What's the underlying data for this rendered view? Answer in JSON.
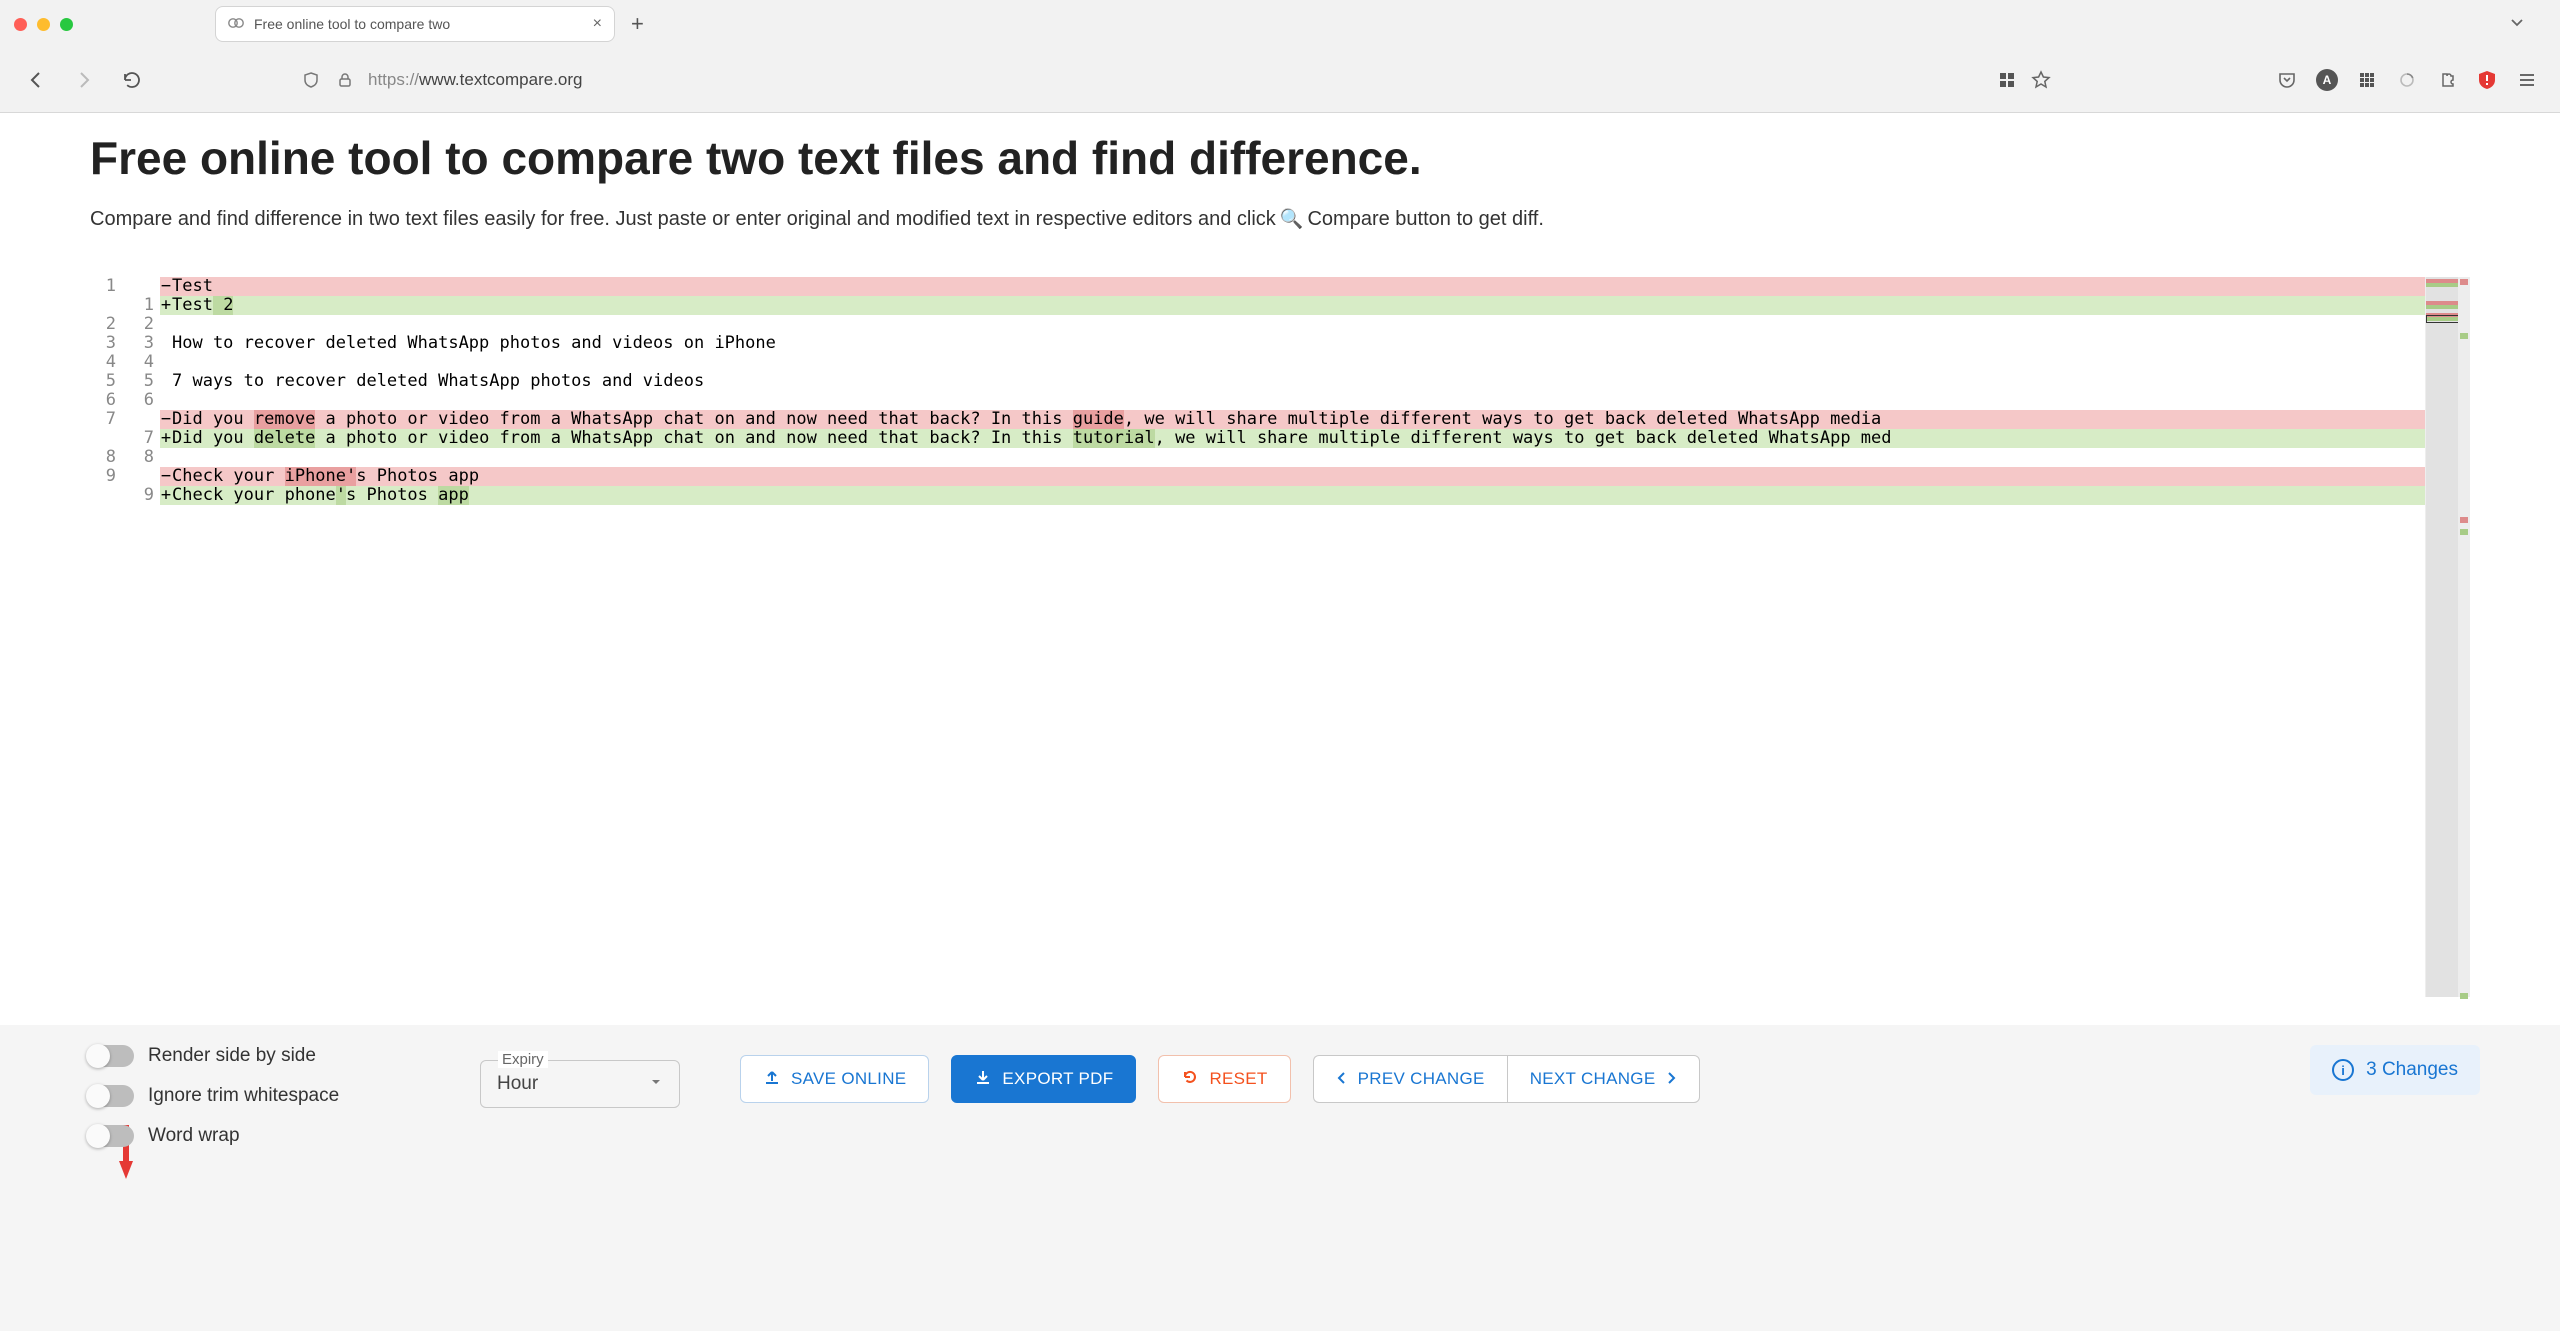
{
  "browser": {
    "tab_title": "Free online tool to compare two",
    "url_scheme": "https://",
    "url_rest": "www.textcompare.org"
  },
  "page": {
    "title": "Free online tool to compare two text files and find difference.",
    "subtitle_before": "Compare and find difference in two text files easily for free. Just paste or enter original and modified text in respective editors and click ",
    "subtitle_after": " Compare button to get diff."
  },
  "diff": {
    "rows": [
      {
        "l": "1",
        "r": "",
        "marker": "−",
        "kind": "del",
        "segs": [
          {
            "t": "Test",
            "hl": false
          }
        ]
      },
      {
        "l": "",
        "r": "1",
        "marker": "+",
        "kind": "add",
        "segs": [
          {
            "t": "Test",
            "hl": false
          },
          {
            "t": " 2",
            "hl": true
          }
        ]
      },
      {
        "l": "2",
        "r": "2",
        "marker": "",
        "kind": "ctx",
        "segs": [
          {
            "t": "",
            "hl": false
          }
        ]
      },
      {
        "l": "3",
        "r": "3",
        "marker": "",
        "kind": "ctx",
        "segs": [
          {
            "t": "How to recover deleted WhatsApp photos and videos on iPhone",
            "hl": false
          }
        ]
      },
      {
        "l": "4",
        "r": "4",
        "marker": "",
        "kind": "ctx",
        "segs": [
          {
            "t": "",
            "hl": false
          }
        ]
      },
      {
        "l": "5",
        "r": "5",
        "marker": "",
        "kind": "ctx",
        "segs": [
          {
            "t": "7 ways to recover deleted WhatsApp photos and videos",
            "hl": false
          }
        ]
      },
      {
        "l": "6",
        "r": "6",
        "marker": "",
        "kind": "ctx",
        "segs": [
          {
            "t": "",
            "hl": false
          }
        ]
      },
      {
        "l": "7",
        "r": "",
        "marker": "−",
        "kind": "del",
        "segs": [
          {
            "t": "Did you ",
            "hl": false
          },
          {
            "t": "remove",
            "hl": true
          },
          {
            "t": " a photo or video from a WhatsApp chat on and now need that back? In this ",
            "hl": false
          },
          {
            "t": "guide",
            "hl": true
          },
          {
            "t": ", we will share multiple different ways to get back deleted WhatsApp media ",
            "hl": false
          }
        ]
      },
      {
        "l": "",
        "r": "7",
        "marker": "+",
        "kind": "add",
        "segs": [
          {
            "t": "Did you ",
            "hl": false
          },
          {
            "t": "delete",
            "hl": true
          },
          {
            "t": " a photo or video from a WhatsApp chat on and now need that back? In this ",
            "hl": false
          },
          {
            "t": "tutorial",
            "hl": true
          },
          {
            "t": ", we will share multiple different ways to get back deleted WhatsApp med",
            "hl": false
          }
        ]
      },
      {
        "l": "8",
        "r": "8",
        "marker": "",
        "kind": "ctx",
        "segs": [
          {
            "t": "",
            "hl": false
          }
        ]
      },
      {
        "l": "9",
        "r": "",
        "marker": "−",
        "kind": "del",
        "segs": [
          {
            "t": "Check your ",
            "hl": false
          },
          {
            "t": "iPhone'",
            "hl": true
          },
          {
            "t": "s Photos app",
            "hl": false
          }
        ]
      },
      {
        "l": "",
        "r": "9",
        "marker": "+",
        "kind": "add",
        "segs": [
          {
            "t": "Check your phone",
            "hl": false
          },
          {
            "t": "'",
            "hl": true
          },
          {
            "t": "s Photos ",
            "hl": false
          },
          {
            "t": "app",
            "hl": true
          }
        ]
      }
    ]
  },
  "controls": {
    "toggles": [
      {
        "label": "Render side by side"
      },
      {
        "label": "Ignore trim whitespace"
      },
      {
        "label": "Word wrap"
      }
    ],
    "expiry_label": "Expiry",
    "expiry_value": "Hour",
    "save_online": "SAVE ONLINE",
    "export_pdf": "EXPORT PDF",
    "reset": "RESET",
    "prev_change": "PREV CHANGE",
    "next_change": "NEXT CHANGE",
    "changes_text": "3 Changes"
  }
}
